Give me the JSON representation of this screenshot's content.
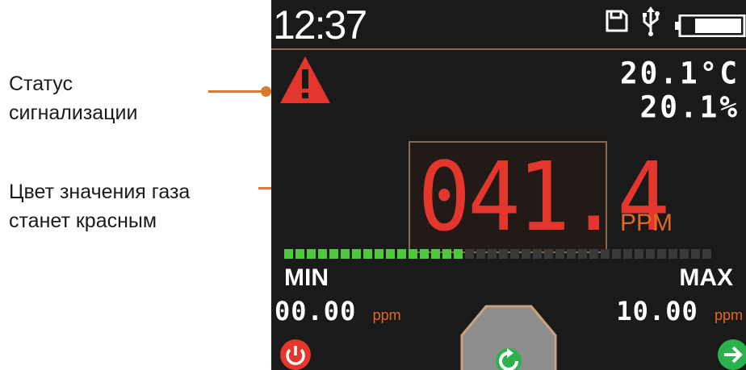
{
  "annotations": {
    "alarm_status": [
      "Статус",
      "сигнализации"
    ],
    "gas_color": [
      "Цвет значения газа",
      "станет красным"
    ]
  },
  "status_bar": {
    "time": "12:37",
    "icons": [
      "save-icon",
      "usb-icon",
      "battery-icon"
    ],
    "battery_level": 0.75
  },
  "alarm": {
    "icon": "warning-triangle-icon",
    "color": "#e3362c"
  },
  "environment": {
    "temperature": "20.1°C",
    "humidity": "20.1%"
  },
  "gas": {
    "value": "041.4",
    "unit": "PPM",
    "color": "#e3362c"
  },
  "bargraph": {
    "segments_total": 38,
    "segments_lit": 16,
    "lit_color": "#4ec93b"
  },
  "limits": {
    "min_label": "MIN",
    "min_value": "00.00",
    "min_unit": "ppm",
    "max_label": "MAX",
    "max_value": "10.00",
    "max_unit": "ppm"
  },
  "buttons": {
    "power": "power-icon",
    "refresh": "refresh-icon",
    "next": "arrow-right-icon"
  },
  "colors": {
    "accent": "#d9782f",
    "screen_bg": "#1a1a1a",
    "border": "#8b6a52"
  }
}
